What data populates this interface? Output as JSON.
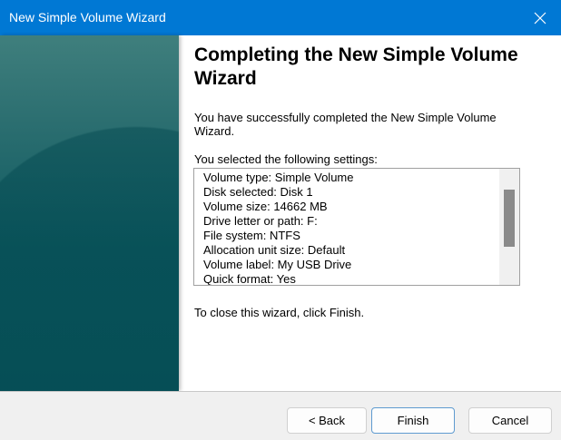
{
  "window": {
    "title": "New Simple Volume Wizard"
  },
  "heading": "Completing the New Simple Volume Wizard",
  "success_text": "You have successfully completed the New Simple Volume Wizard.",
  "settings_label": "You selected the following settings:",
  "settings": [
    "Volume type: Simple Volume",
    "Disk selected: Disk 1",
    "Volume size: 14662 MB",
    "Drive letter or path: F:",
    "File system: NTFS",
    "Allocation unit size: Default",
    "Volume label: My USB Drive",
    "Quick format: Yes"
  ],
  "close_text": "To close this wizard, click Finish.",
  "buttons": {
    "back": "< Back",
    "finish": "Finish",
    "cancel": "Cancel"
  }
}
